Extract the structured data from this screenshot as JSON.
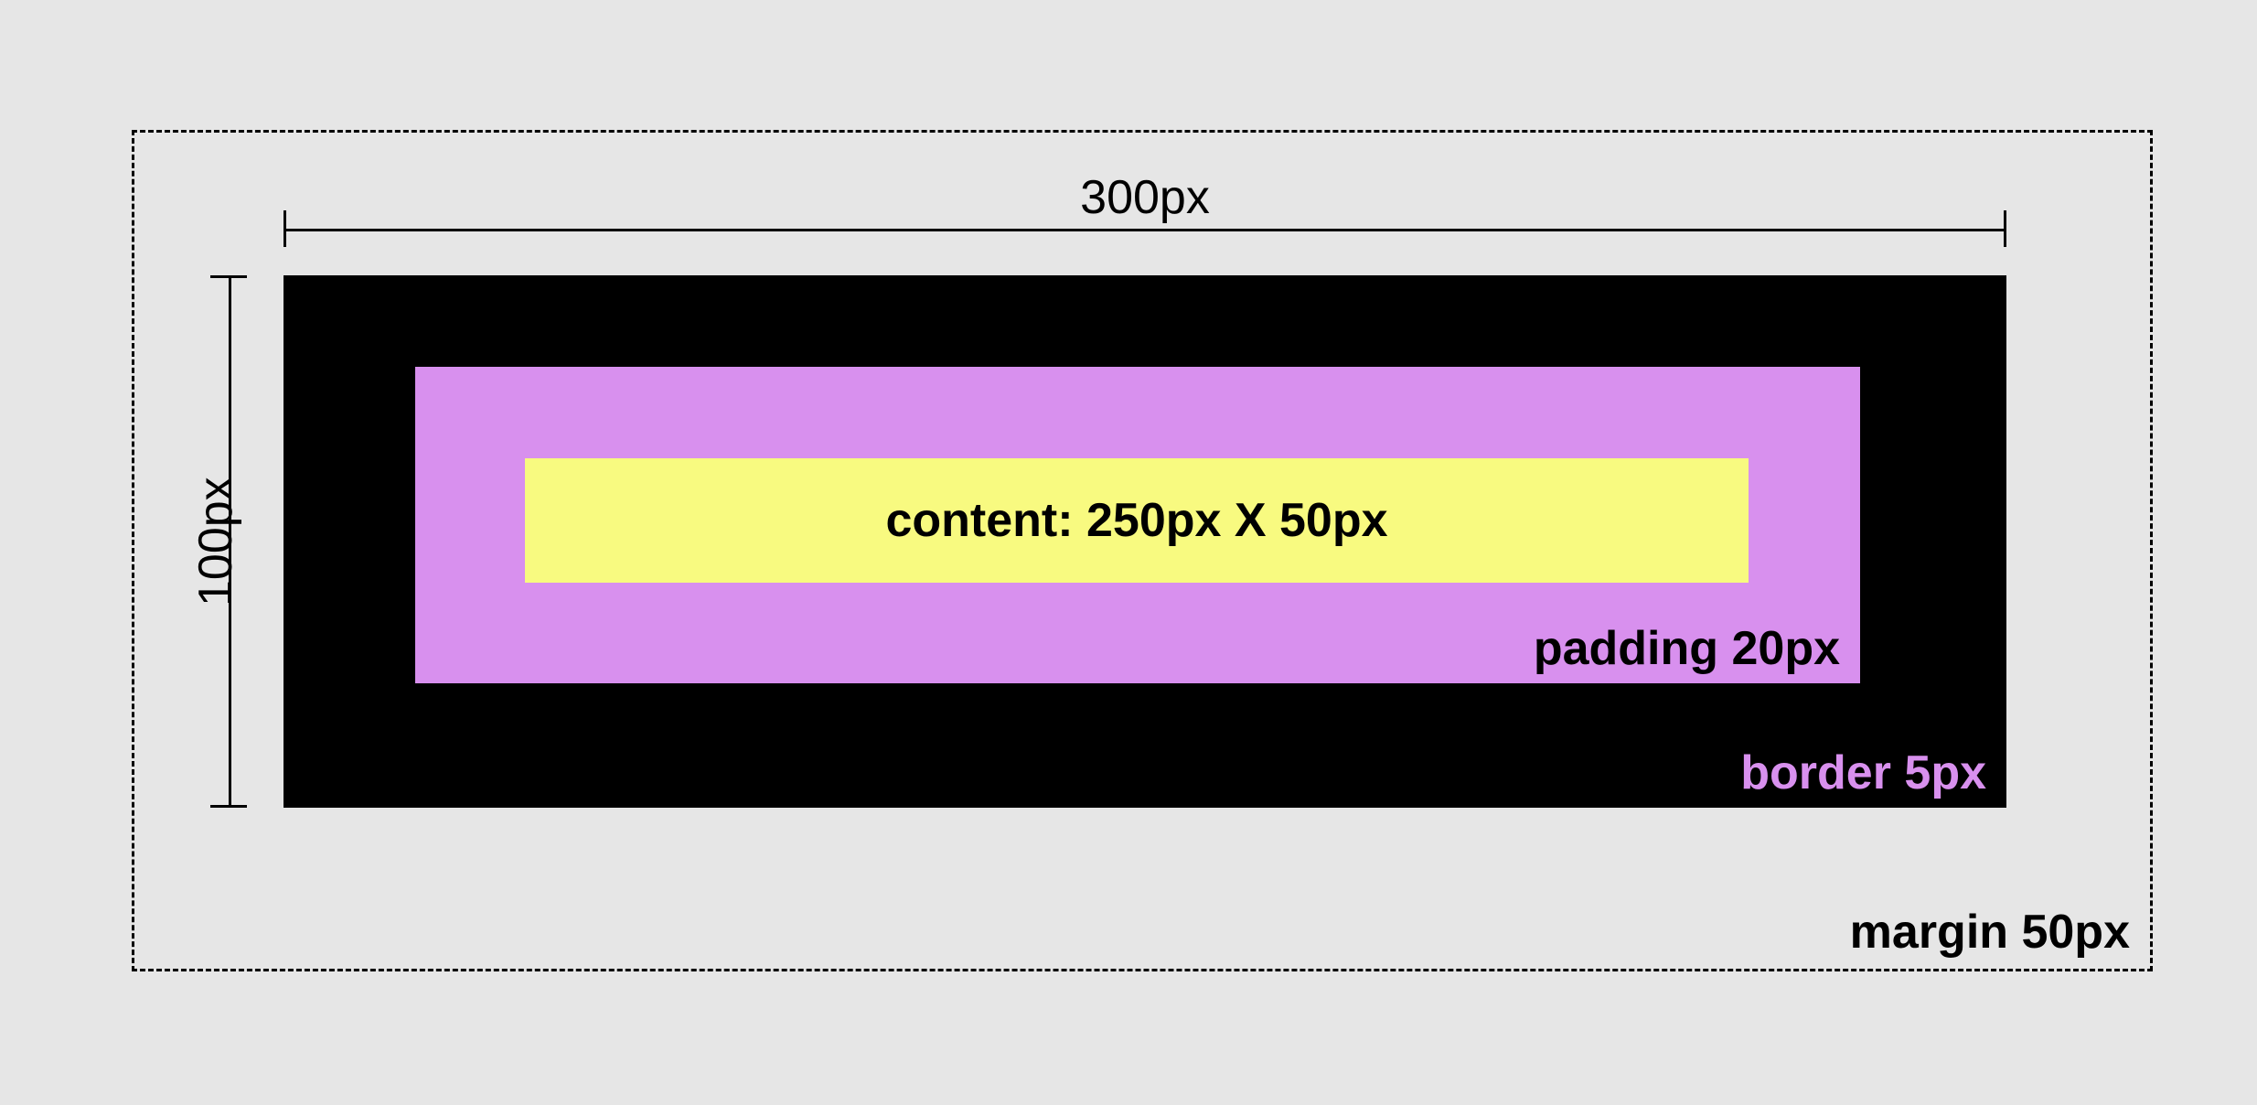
{
  "dimensions": {
    "width_label": "300px",
    "height_label": "100px"
  },
  "labels": {
    "content": "content: 250px X 50px",
    "padding": "padding 20px",
    "border": "border 5px",
    "margin": "margin 50px"
  },
  "colors": {
    "background": "#e6e6e6",
    "border_box": "#000000",
    "padding_box": "#d890ee",
    "content_box": "#f8fa80"
  }
}
